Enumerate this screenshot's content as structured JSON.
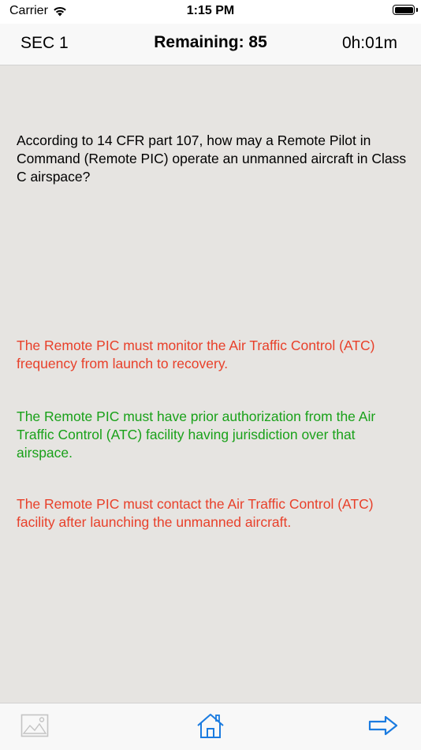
{
  "status_bar": {
    "carrier": "Carrier",
    "time": "1:15 PM"
  },
  "header": {
    "section": "SEC 1",
    "remaining": "Remaining: 85",
    "timer": "0h:01m"
  },
  "question": {
    "text": "According to 14 CFR part 107, how may a Remote Pilot in Command (Remote PIC) operate an unmanned aircraft in Class C airspace?"
  },
  "answers": [
    {
      "text": "The Remote PIC must monitor the Air Traffic Control (ATC) frequency from launch to recovery.",
      "status": "incorrect",
      "color": "#e8402a"
    },
    {
      "text": "The Remote PIC must have prior authorization from the Air Traffic Control (ATC) facility having jurisdiction over that airspace.",
      "status": "correct",
      "color": "#19a119"
    },
    {
      "text": "The Remote PIC must contact the Air Traffic Control (ATC) facility after launching the unmanned aircraft.",
      "status": "incorrect",
      "color": "#e8402a"
    }
  ],
  "toolbar": {
    "items": [
      {
        "icon": "image-icon"
      },
      {
        "icon": "home-icon"
      },
      {
        "icon": "arrow-right-icon"
      }
    ]
  },
  "colors": {
    "accent": "#1a7be0",
    "content_background": "#e6e4e1",
    "bar_background": "#f8f8f8"
  }
}
